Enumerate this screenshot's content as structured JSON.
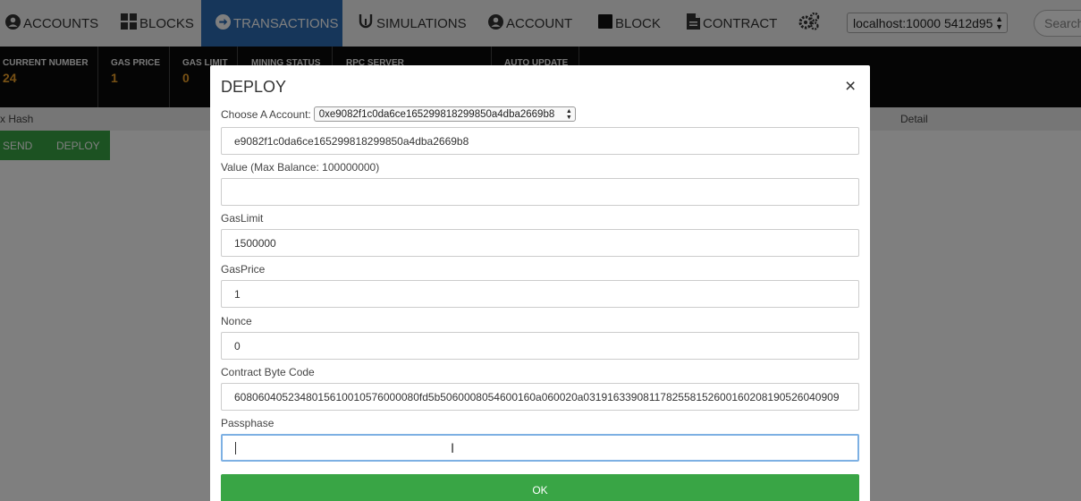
{
  "nav": {
    "items": [
      {
        "label": "ACCOUNTS",
        "icon": "account-circle-icon"
      },
      {
        "label": "BLOCKS",
        "icon": "blocks-grid-icon"
      },
      {
        "label": "TRANSACTIONS",
        "icon": "arrow-circle-icon"
      },
      {
        "label": "SIMULATIONS",
        "icon": "simulation-icon"
      },
      {
        "label": "ACCOUNT",
        "icon": "account-circle-icon"
      },
      {
        "label": "BLOCK",
        "icon": "block-square-icon"
      },
      {
        "label": "CONTRACT",
        "icon": "document-icon"
      }
    ],
    "settings_icon": "gears-icon",
    "node_select": "localhost:10000 5412d95",
    "search_placeholder": "Search"
  },
  "stats": [
    {
      "label": "CURRENT NUMBER",
      "value": "24"
    },
    {
      "label": "GAS PRICE",
      "value": "1"
    },
    {
      "label": "GAS LIMIT",
      "value": "0"
    },
    {
      "label": "MINING STATUS",
      "value": ""
    },
    {
      "label": "RPC SERVER",
      "value": ""
    },
    {
      "label": "AUTO UPDATE",
      "value": ""
    }
  ],
  "table": {
    "hash_header": "x Hash",
    "detail_header": "Detail"
  },
  "actions": {
    "send": "SEND",
    "deploy": "DEPLOY"
  },
  "modal": {
    "title": "DEPLOY",
    "close": "×",
    "account_label": "Choose A Account:",
    "account_value": "0xe9082f1c0da6ce165299818299850a4dba2669b8",
    "address_value": "e9082f1c0da6ce165299818299850a4dba2669b8",
    "value_label": "Value (Max Balance: 100000000)",
    "value_value": "",
    "gaslimit_label": "GasLimit",
    "gaslimit_value": "1500000",
    "gasprice_label": "GasPrice",
    "gasprice_value": "1",
    "nonce_label": "Nonce",
    "nonce_value": "0",
    "bytecode_label": "Contract Byte Code",
    "bytecode_value": "6080604052348015610010576000080fd5b5060008054600160a060020a0319163390811782558152600160208190526040909",
    "passphrase_label": "Passphase",
    "passphrase_value": "",
    "ok_label": "OK"
  },
  "colors": {
    "nav_active": "#2d6db5",
    "stat_value": "#f0a22a",
    "ok_button": "#39a545"
  }
}
